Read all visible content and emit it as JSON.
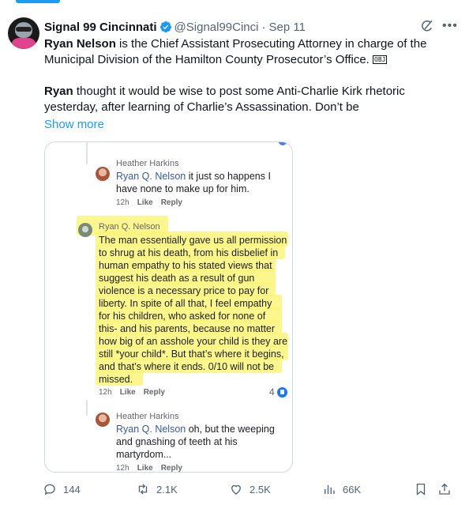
{
  "post": {
    "author_name": "Signal 99 Cincinnati",
    "handle": "@Signal99Cinci",
    "separator": "·",
    "date": "Sep 11",
    "text_line1_bold": "Ryan Nelson",
    "text_line1_rest": " is the Chief Assistant Prosecuting Attorney in charge of the Municipal Division of the Hamilton County Prosecutor’s Office. ",
    "obj_box": "OBJ",
    "text_line2_bold": "Ryan",
    "text_line2_rest": " thought it would be wise to post some Anti-Charlie Kirk rhetoric yesterday, after learning of Charlie’s Assassination. Don’t be",
    "show_more": "Show more",
    "icons": [
      "verified-badge-icon",
      "grok-icon",
      "more-icon"
    ],
    "accent_color": "#1d9bf0"
  },
  "media": {
    "comment1": {
      "author": "Heather Harkins",
      "mention": "Ryan Q. Nelson",
      "text_a": " it just so happens I",
      "text_b": "have none to make up for him.",
      "time": "12h",
      "like": "Like",
      "reply": "Reply"
    },
    "comment2": {
      "author": "Ryan Q. Nelson",
      "lines": [
        "The man essentially gave us all permission",
        "to shrug at his death, from his disbelief in",
        "human empathy to his stated views that",
        "suggest his death as a result of gun",
        "violence is a necessary price to pay for",
        "liberty. In spite of all that, I feel empathy",
        "for his children, who asked for none of",
        "this- and his parents, because no matter",
        "how big of an asshole your child is they are",
        "still *your child*. But that’s where it begins,",
        "and that’s where it ends. 0/10 will not be",
        "missed."
      ],
      "time": "12h",
      "like": "Like",
      "reply": "Reply",
      "reaction_count": "4"
    },
    "comment3": {
      "author": "Heather Harkins",
      "mention": "Ryan Q. Nelson",
      "text_a": " oh, but the weeping",
      "text_b": "and gnashing of teeth at his",
      "text_c": "martyrdom...",
      "time": "12h",
      "like": "Like",
      "reply": "Reply"
    },
    "highlight_color": "#fbf57a"
  },
  "actions": {
    "replies": "144",
    "reposts": "2.1K",
    "likes": "2.5K",
    "views": "66K"
  }
}
